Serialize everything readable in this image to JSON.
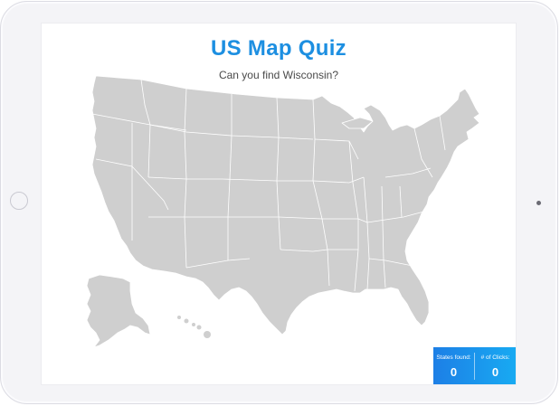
{
  "quiz": {
    "title": "US Map Quiz",
    "prompt": "Can you find Wisconsin?"
  },
  "score": {
    "states_found_label": "States found:",
    "states_found_value": "0",
    "clicks_label": "# of Clicks:",
    "clicks_value": "0"
  },
  "colors": {
    "accent": "#1d8fe1",
    "map_fill": "#cfcfcf",
    "panel_gradient_start": "#1d7fe6",
    "panel_gradient_end": "#18aaf2"
  }
}
